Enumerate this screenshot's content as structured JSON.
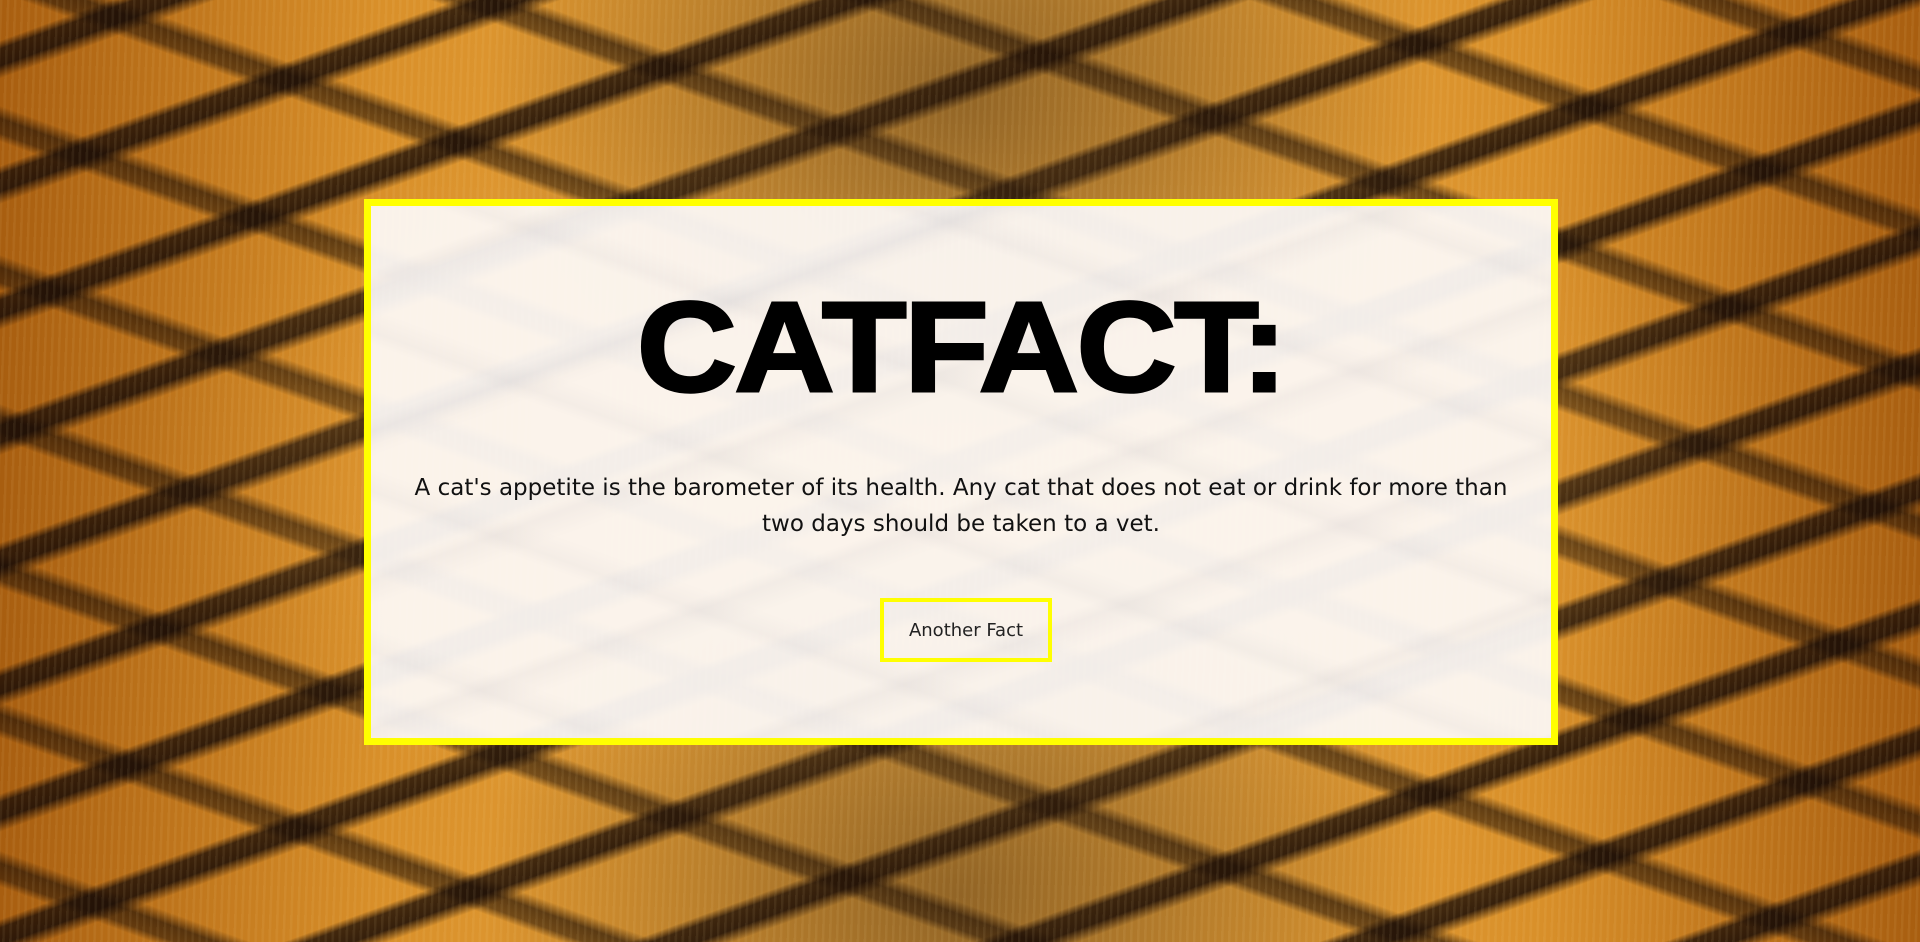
{
  "page": {
    "title": "CATFACT:",
    "fact": "A cat's appetite is the barometer of its health. Any cat that does not eat or drink for more than two days should be taken to a vet.",
    "button_label": "Another Fact"
  },
  "colors": {
    "card_border": "#ffff00",
    "button_border": "#ffff00",
    "title_text": "#000000",
    "body_text": "#111111"
  },
  "background": {
    "type": "tiger-fur-texture"
  }
}
